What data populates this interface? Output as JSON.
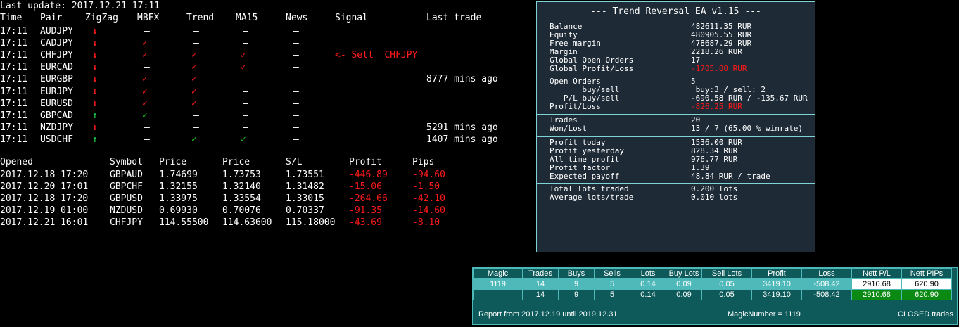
{
  "last_update": "Last update: 2017.12.21 17:11",
  "signals": {
    "headers": [
      "Time",
      "Pair",
      "ZigZag",
      "MBFX",
      "Trend",
      "MA15",
      "News",
      "Signal",
      "Last trade"
    ],
    "rows": [
      {
        "time": "17:11",
        "pair": "AUDJPY",
        "zz": "down",
        "mbfx": "–",
        "trend": "–",
        "ma15": "–",
        "news": "–",
        "signal": "",
        "last": ""
      },
      {
        "time": "17:11",
        "pair": "CADJPY",
        "zz": "down",
        "mbfx": "✓r",
        "trend": "–",
        "ma15": "–",
        "news": "–",
        "signal": "",
        "last": ""
      },
      {
        "time": "17:11",
        "pair": "CHFJPY",
        "zz": "down",
        "mbfx": "✓r",
        "trend": "✓r",
        "ma15": "✓r",
        "news": "–",
        "signal": "<- Sell  CHFJPY",
        "last": ""
      },
      {
        "time": "17:11",
        "pair": "EURCAD",
        "zz": "down",
        "mbfx": "–",
        "trend": "✓r",
        "ma15": "✓r",
        "news": "–",
        "signal": "",
        "last": ""
      },
      {
        "time": "17:11",
        "pair": "EURGBP",
        "zz": "down",
        "mbfx": "✓r",
        "trend": "✓r",
        "ma15": "–",
        "news": "–",
        "signal": "",
        "last": "8777 mins ago"
      },
      {
        "time": "17:11",
        "pair": "EURJPY",
        "zz": "down",
        "mbfx": "✓r",
        "trend": "✓r",
        "ma15": "–",
        "news": "–",
        "signal": "",
        "last": ""
      },
      {
        "time": "17:11",
        "pair": "EURUSD",
        "zz": "down",
        "mbfx": "✓r",
        "trend": "✓r",
        "ma15": "–",
        "news": "–",
        "signal": "",
        "last": ""
      },
      {
        "time": "17:11",
        "pair": "GBPCAD",
        "zz": "up",
        "mbfx": "✓g",
        "trend": "–",
        "ma15": "–",
        "news": "–",
        "signal": "",
        "last": ""
      },
      {
        "time": "17:11",
        "pair": "NZDJPY",
        "zz": "down",
        "mbfx": "–",
        "trend": "–",
        "ma15": "–",
        "news": "–",
        "signal": "",
        "last": "5291 mins ago"
      },
      {
        "time": "17:11",
        "pair": "USDCHF",
        "zz": "up",
        "mbfx": "–",
        "trend": "✓g",
        "ma15": "✓g",
        "news": "–",
        "signal": "",
        "last": "1407 mins ago"
      }
    ]
  },
  "orders": {
    "headers": [
      "Opened",
      "Symbol",
      "Price",
      "Price",
      "S/L",
      "Profit",
      "Pips"
    ],
    "rows": [
      [
        "2017.12.18 17:20",
        "GBPAUD",
        "1.74699",
        "1.73753",
        "1.73551",
        "-446.89",
        "-94.60"
      ],
      [
        "2017.12.20 17:01",
        "GBPCHF",
        "1.32155",
        "1.32140",
        "1.31482",
        "-15.06",
        "-1.50"
      ],
      [
        "2017.12.18 17:20",
        "GBPUSD",
        "1.33975",
        "1.33554",
        "1.33015",
        "-264.66",
        "-42.10"
      ],
      [
        "2017.12.19 01:00",
        "NZDUSD",
        "0.69930",
        "0.70076",
        "0.70337",
        "-91.35",
        "-14.60"
      ],
      [
        "2017.12.21 16:01",
        "CHFJPY",
        "114.55500",
        "114.63600",
        "115.18000",
        "-43.69",
        "-8.10"
      ]
    ]
  },
  "ea": {
    "title": "--- Trend Reversal EA v1.15 ---",
    "rows": [
      {
        "l": "Balance",
        "v": "482611.35 RUR"
      },
      {
        "l": "Equity",
        "v": "480905.55 RUR"
      },
      {
        "l": "Free margin",
        "v": "478687.29 RUR"
      },
      {
        "l": "Margin",
        "v": "2218.26 RUR"
      },
      {
        "l": "Global Open Orders",
        "v": "17"
      },
      {
        "l": "Global Profit/Loss",
        "v": "-1705.80 RUR",
        "red": true
      },
      {
        "l": "Open Orders",
        "v": "5"
      },
      {
        "l": "       buy/sell",
        "v": " buy:3 / sell: 2"
      },
      {
        "l": "   P/L buy/sell",
        "v": "-690.58 RUR / -135.67 RUR"
      },
      {
        "l": "Profit/Loss",
        "v": "-826.25 RUR",
        "red": true
      },
      {
        "l": "Trades",
        "v": "20"
      },
      {
        "l": "Won/Lost",
        "v": "13 / 7 (65.00 % winrate)"
      },
      {
        "l": "Profit today",
        "v": "1536.00 RUR"
      },
      {
        "l": "Profit yesterday",
        "v": "828.34 RUR"
      },
      {
        "l": "All time profit",
        "v": "976.77 RUR"
      },
      {
        "l": "Profit factor",
        "v": "1.39"
      },
      {
        "l": "Expected payoff",
        "v": "48.84 RUR / trade"
      },
      {
        "l": "Total lots traded",
        "v": "0.200 lots"
      },
      {
        "l": "Average lots/trade",
        "v": "0.010 lots"
      }
    ]
  },
  "stats": {
    "headers": [
      "Magic",
      "Trades",
      "Buys",
      "Sells",
      "Lots",
      "Buy Lots",
      "Sell Lots",
      "Profit",
      "Loss",
      "Nett P/L",
      "Nett PIPs"
    ],
    "row1": [
      "1119",
      "14",
      "9",
      "5",
      "0.14",
      "0.09",
      "0.05",
      "3419.10",
      "-508.42",
      "2910.68",
      "620.90"
    ],
    "row2": [
      "",
      "14",
      "9",
      "5",
      "0.14",
      "0.09",
      "0.05",
      "3419.10",
      "-508.42",
      "2910.68",
      "620.90"
    ],
    "report": "Report from 2017.12.19 until 2019.12.31",
    "magic": "MagicNumber = 1119",
    "closed": "CLOSED trades"
  }
}
